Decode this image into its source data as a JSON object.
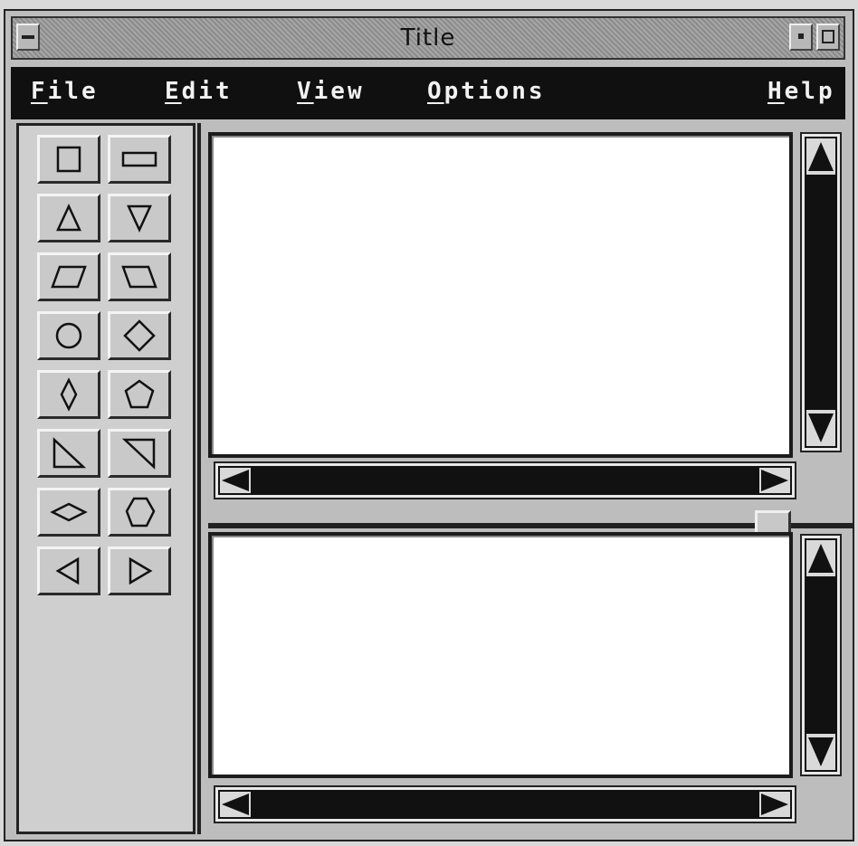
{
  "window": {
    "title": "Title"
  },
  "menu": [
    {
      "label": "File",
      "mnemonic": "F",
      "rest": "ile"
    },
    {
      "label": "Edit",
      "mnemonic": "E",
      "rest": "dit"
    },
    {
      "label": "View",
      "mnemonic": "V",
      "rest": "iew"
    },
    {
      "label": "Options",
      "mnemonic": "O",
      "rest": "ptions"
    },
    {
      "label": "Help",
      "mnemonic": "H",
      "rest": "elp"
    }
  ],
  "palette": {
    "tools": [
      "square-icon",
      "rectangle-icon",
      "triangle-up-icon",
      "triangle-down-icon",
      "parallelogram-right-icon",
      "parallelogram-left-icon",
      "circle-icon",
      "diamond-icon",
      "tall-diamond-icon",
      "pentagon-icon",
      "right-triangle-icon",
      "right-triangle-flipped-icon",
      "wide-diamond-icon",
      "hexagon-icon",
      "triangle-left-icon",
      "triangle-right-icon"
    ]
  },
  "panes": [
    "top-drawing-pane",
    "bottom-drawing-pane"
  ],
  "colors": {
    "menubar": "#101010",
    "canvas": "#ffffff",
    "scrollbar": "#111111"
  }
}
